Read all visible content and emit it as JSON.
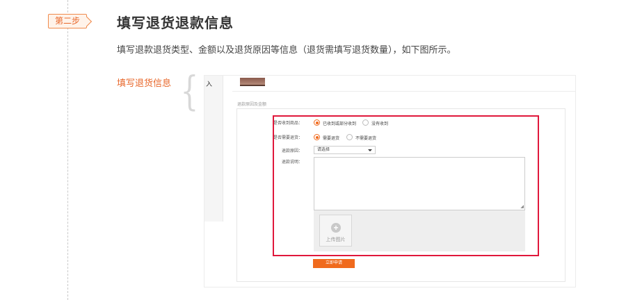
{
  "step": {
    "badge": "第二步",
    "title": "填写退货退款信息",
    "description": "填写退款退货类型、金额以及退货原因等信息（退货需填写退货数量），如下图所示。"
  },
  "side_label": "填写退货信息",
  "screenshot": {
    "left_text": "入",
    "section_label": "退款原因及金额",
    "form": {
      "received": {
        "label": "是否收到商品：",
        "options": [
          "已收到或部分收到",
          "没有收到"
        ],
        "selected": "已收到或部分收到"
      },
      "need_return": {
        "label": "是否需要退货：",
        "options": [
          "需要退货",
          "不需要退货"
        ],
        "selected": "需要退货"
      },
      "reason": {
        "label": "退款原因：",
        "value": "请选择"
      },
      "explanation": {
        "label": "退款说明："
      },
      "upload": {
        "label": "上传图片"
      },
      "submit_label": "立即申请"
    }
  },
  "colors": {
    "accent": "#f06a1d",
    "highlight": "#e0173b",
    "badge_text": "#e8672a"
  }
}
